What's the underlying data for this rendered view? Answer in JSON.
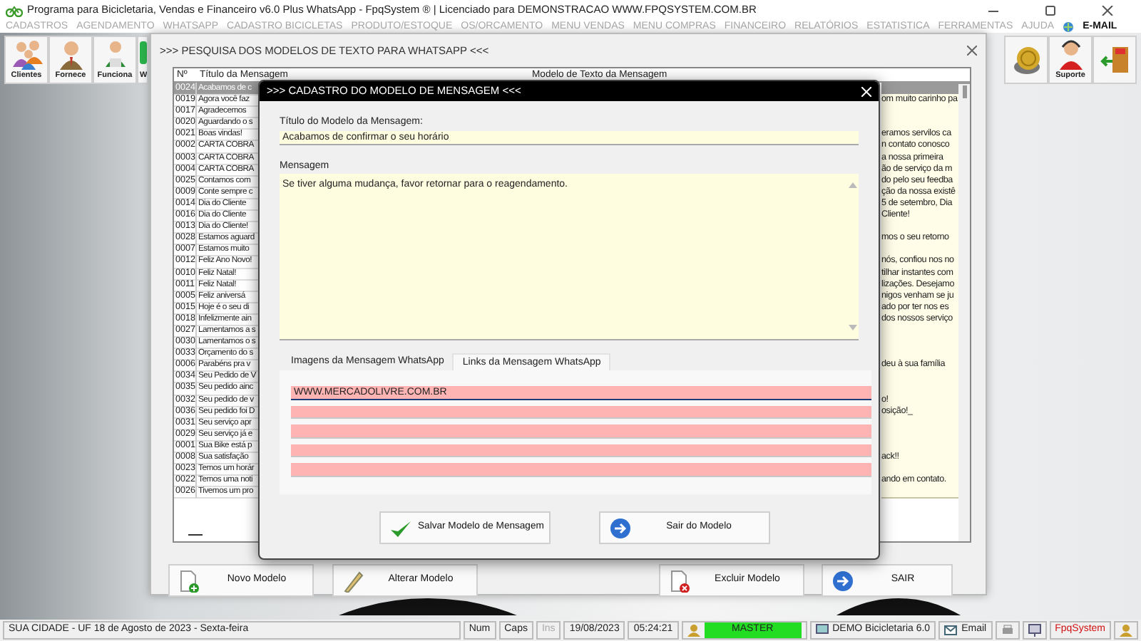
{
  "window": {
    "title": "Programa para Bicicletaria, Vendas e Financeiro v6.0 Plus WhatsApp - FpqSystem ® | Licenciado para  DEMONSTRACAO WWW.FPQSYSTEM.COM.BR"
  },
  "menu": [
    "CADASTROS",
    "AGENDAMENTO",
    "WHATSAPP",
    "CADASTRO BICICLETAS",
    "PRODUTO/ESTOQUE",
    "OS/ORCAMENTO",
    "MENU VENDAS",
    "MENU COMPRAS",
    "FINANCEIRO",
    "RELATÓRIOS",
    "ESTATISTICA",
    "FERRAMENTAS",
    "AJUDA"
  ],
  "menu_email": "E-MAIL",
  "toolbar_left": [
    {
      "kind": "clients",
      "label": "Clientes"
    },
    {
      "kind": "supplier",
      "label": "Fornece"
    },
    {
      "kind": "employee",
      "label": "Funciona"
    },
    {
      "kind": "whatsapp",
      "label": "W"
    }
  ],
  "toolbar_right": [
    {
      "kind": "coins"
    },
    {
      "kind": "support",
      "label": "Suporte"
    },
    {
      "kind": "exit"
    }
  ],
  "search_window": {
    "title": ">>> PESQUISA DOS MODELOS DE TEXTO PARA WHATSAPP <<<",
    "columns": [
      "Nº",
      "Título da Mensagem",
      "Modelo de Texto da Mensagem"
    ],
    "rows": [
      {
        "number": "0024",
        "title": "Acabamos de c",
        "selected": true
      },
      {
        "number": "0019",
        "title": "Agora você faz",
        "text": "om muito carinho pa",
        "selected": false
      },
      {
        "number": "0017",
        "title": "Agradecemos",
        "selected": false
      },
      {
        "number": "0020",
        "title": "Aguardando o s",
        "selected": false
      },
      {
        "number": "0021",
        "title": "Boas vindas!",
        "text": "eramos servilos ca",
        "selected": false
      },
      {
        "number": "0002",
        "title": "CARTA COBRA",
        "text": "n contato conosco",
        "selected": false
      },
      {
        "number": "0003",
        "title": "CARTA COBRA",
        "text": "a nossa primeira",
        "selected": false
      },
      {
        "number": "0004",
        "title": "CARTA COBRA",
        "text": "ão de serviço da m",
        "selected": false
      },
      {
        "number": "0025",
        "title": "Contamos com",
        "text": "do pelo seu feedba",
        "selected": false
      },
      {
        "number": "0009",
        "title": "Conte sempre c",
        "text": "ção da nossa existê",
        "selected": false
      },
      {
        "number": "0014",
        "title": "Dia do Cliente",
        "text": "5 de setembro, Dia",
        "selected": false
      },
      {
        "number": "0016",
        "title": "Dia do Cliente",
        "text": "Cliente!",
        "selected": false
      },
      {
        "number": "0013",
        "title": "Dia do Cliente!",
        "selected": false
      },
      {
        "number": "0028",
        "title": "Estamos aguard",
        "text": "mos o seu retorno",
        "selected": false
      },
      {
        "number": "0007",
        "title": "Estamos muito",
        "selected": false
      },
      {
        "number": "0012",
        "title": "Feliz Ano Novo!",
        "text": "nós, confiou nos no",
        "selected": false
      },
      {
        "number": "0010",
        "title": "Feliz Natal!",
        "text": "tilhar instantes com",
        "selected": false
      },
      {
        "number": "0011",
        "title": "Feliz Natal!",
        "text": "lizações. Desejamo",
        "selected": false
      },
      {
        "number": "0005",
        "title": "Feliz aniversá",
        "text": "nigos venham se ju",
        "selected": false
      },
      {
        "number": "0015",
        "title": "Hoje é o seu di",
        "text": "ado por ter nos es",
        "selected": false
      },
      {
        "number": "0018",
        "title": "Infelizmente ain",
        "text": "dos nossos serviço",
        "selected": false
      },
      {
        "number": "0027",
        "title": "Lamentamos a s",
        "selected": false
      },
      {
        "number": "0030",
        "title": "Lamentamos o s",
        "selected": false
      },
      {
        "number": "0033",
        "title": "Orçamento do s",
        "selected": false
      },
      {
        "number": "0006",
        "title": "Parabéns pra v",
        "text": "deu à sua família",
        "selected": false
      },
      {
        "number": "0034",
        "title": "Seu Pedido de V",
        "selected": false
      },
      {
        "number": "0035",
        "title": "Seu pedido ainc",
        "selected": false
      },
      {
        "number": "0032",
        "title": "Seu pedido de v",
        "text": "o!",
        "selected": false
      },
      {
        "number": "0036",
        "title": "Seu pedido foi D",
        "text": "osição!_",
        "selected": false
      },
      {
        "number": "0031",
        "title": "Seu serviço apr",
        "selected": false
      },
      {
        "number": "0029",
        "title": "Seu serviço já e",
        "selected": false
      },
      {
        "number": "0001",
        "title": "Sua Bike está p",
        "selected": false
      },
      {
        "number": "0008",
        "title": "Sua satisfação",
        "text": "ack!!",
        "selected": false
      },
      {
        "number": "0023",
        "title": "Temos um horár",
        "selected": false
      },
      {
        "number": "0022",
        "title": "Temos uma noti",
        "text": "ando em contato.",
        "selected": false
      },
      {
        "number": "0026",
        "title": "Tivemos um pro",
        "selected": false
      }
    ],
    "buttons": [
      {
        "kind": "new",
        "label": "Novo Modelo"
      },
      {
        "kind": "edit",
        "label": "Alterar Modelo"
      },
      {
        "kind": "delete",
        "label": "Excluir Modelo"
      },
      {
        "kind": "exit",
        "label": "SAIR"
      }
    ]
  },
  "dialog": {
    "title": ">>> CADASTRO DO MODELO DE MENSAGEM <<<",
    "title_label": "Título do Modelo da Mensagem:",
    "title_value": "Acabamos de confirmar o seu horário",
    "message_label": "Mensagem",
    "message_value": "Se tiver alguma mudança, favor retornar para o reagendamento.",
    "tabs": [
      {
        "label": "Imagens da Mensagem WhatsApp",
        "selected": false
      },
      {
        "label": "Links da Mensagem WhatsApp",
        "selected": true
      }
    ],
    "links": [
      {
        "value": "WWW.MERCADOLIVRE.COM.BR",
        "focused": true
      },
      {
        "focused": false
      },
      {
        "focused": false
      },
      {
        "focused": false
      },
      {
        "focused": false
      }
    ],
    "buttons": [
      {
        "kind": "save",
        "label": "Salvar Modelo de Mensagem"
      },
      {
        "kind": "exit",
        "label": "Sair do Modelo"
      }
    ]
  },
  "status_bar": {
    "location": "SUA CIDADE - UF 18 de Agosto de 2023 - Sexta-feira",
    "keys": [
      {
        "label": "Num",
        "disabled": false
      },
      {
        "label": "Caps",
        "disabled": false
      },
      {
        "label": "Ins",
        "disabled": true
      }
    ],
    "date": "19/08/2023",
    "time": "05:24:21",
    "user": "MASTER",
    "company": "DEMO Bicicletaria 6.0",
    "email": "Email",
    "brand": "FpqSystem"
  }
}
